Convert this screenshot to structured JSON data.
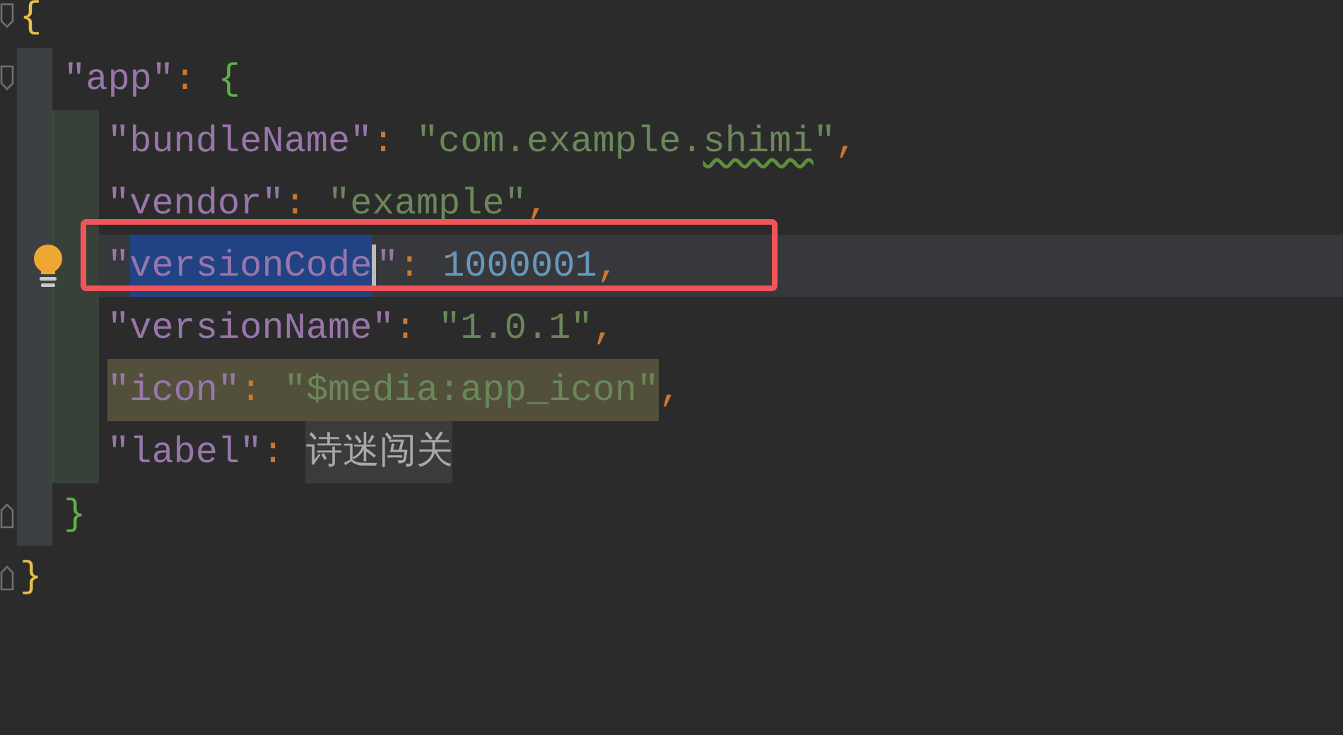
{
  "lines": [
    {
      "fold_marker": true,
      "current": false,
      "annotated": false,
      "intention": false,
      "tokens": [
        {
          "kind": "brace-outer",
          "text": "{"
        }
      ],
      "children": [
        {
          "fold_marker": true,
          "current": false,
          "annotated": false,
          "intention": false,
          "tokens": [
            {
              "kind": "key",
              "text": "\"app\""
            },
            {
              "kind": "punct",
              "text": ": "
            },
            {
              "kind": "brace-inner",
              "text": "{"
            }
          ],
          "children": [
            {
              "fold_marker": false,
              "current": false,
              "annotated": false,
              "intention": false,
              "tokens": [
                {
                  "kind": "key",
                  "text": "\"bundleName\""
                },
                {
                  "kind": "punct",
                  "text": ": "
                },
                {
                  "kind": "string",
                  "text": "\"com.example."
                },
                {
                  "kind": "typo",
                  "text": "shimi"
                },
                {
                  "kind": "string",
                  "text": "\""
                },
                {
                  "kind": "punct",
                  "text": ","
                }
              ]
            },
            {
              "fold_marker": false,
              "current": false,
              "annotated": false,
              "intention": false,
              "tokens": [
                {
                  "kind": "key",
                  "text": "\"vendor\""
                },
                {
                  "kind": "punct",
                  "text": ": "
                },
                {
                  "kind": "string",
                  "text": "\"example\""
                },
                {
                  "kind": "punct",
                  "text": ","
                }
              ]
            },
            {
              "fold_marker": false,
              "current": true,
              "annotated": true,
              "intention": true,
              "tokens": [
                {
                  "kind": "key",
                  "text": "\""
                },
                {
                  "kind": "key-selected",
                  "text": "versionCode"
                },
                {
                  "kind": "caret"
                },
                {
                  "kind": "key",
                  "text": "\""
                },
                {
                  "kind": "punct",
                  "text": ": "
                },
                {
                  "kind": "number",
                  "text": "1000001"
                },
                {
                  "kind": "punct",
                  "text": ","
                }
              ]
            },
            {
              "fold_marker": false,
              "current": false,
              "annotated": false,
              "intention": false,
              "tokens": [
                {
                  "kind": "key",
                  "text": "\"versionName\""
                },
                {
                  "kind": "punct",
                  "text": ": "
                },
                {
                  "kind": "string",
                  "text": "\"1.0.1\""
                },
                {
                  "kind": "punct",
                  "text": ","
                }
              ]
            },
            {
              "fold_marker": false,
              "current": false,
              "annotated": false,
              "intention": false,
              "tokens": [
                {
                  "kind": "key-warning",
                  "text": "\"icon\""
                },
                {
                  "kind": "punct-warning",
                  "text": ": "
                },
                {
                  "kind": "string-warning",
                  "text": "\"$media:app_icon\""
                },
                {
                  "kind": "punct",
                  "text": ","
                }
              ]
            },
            {
              "fold_marker": false,
              "current": false,
              "annotated": false,
              "intention": false,
              "tokens": [
                {
                  "kind": "key",
                  "text": "\"label\""
                },
                {
                  "kind": "punct",
                  "text": ": "
                },
                {
                  "kind": "plain-error",
                  "text": "诗迷闯关"
                }
              ]
            }
          ]
        },
        {
          "fold_marker": true,
          "current": false,
          "annotated": false,
          "intention": false,
          "tokens": [
            {
              "kind": "brace-inner",
              "text": "}"
            }
          ]
        }
      ]
    },
    {
      "fold_marker": true,
      "current": false,
      "annotated": false,
      "intention": false,
      "tokens": [
        {
          "kind": "brace-outer",
          "text": "}"
        }
      ]
    }
  ]
}
